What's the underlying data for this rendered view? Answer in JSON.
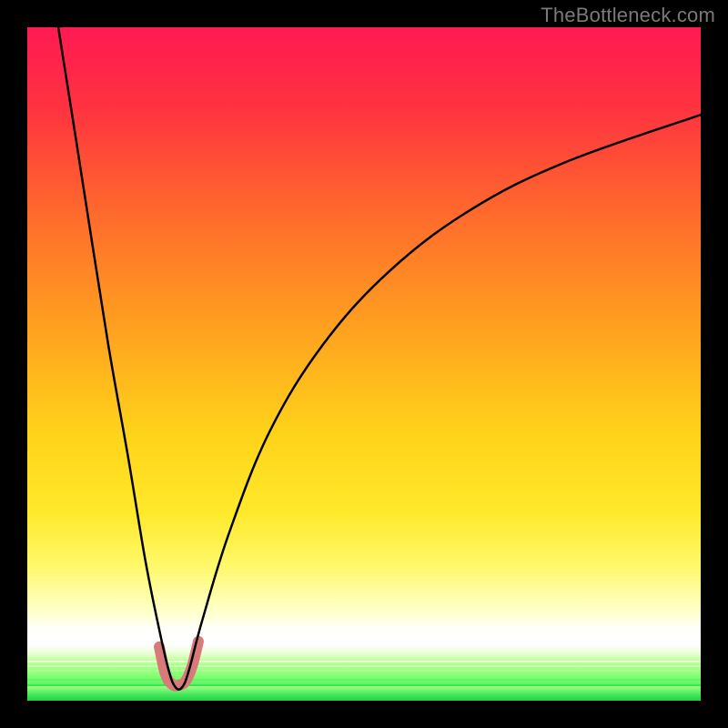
{
  "watermark": "TheBottleneck.com",
  "chart_data": {
    "type": "line",
    "title": "",
    "xlabel": "",
    "ylabel": "",
    "xlim": [
      0,
      100
    ],
    "ylim": [
      0,
      100
    ],
    "grid": false,
    "legend": null,
    "notch_x_percent": 22,
    "series": [
      {
        "name": "gradient-background",
        "kind": "vertical-gradient",
        "stops": [
          {
            "pct": 0,
            "color": "#ff1a52"
          },
          {
            "pct": 12,
            "color": "#ff3340"
          },
          {
            "pct": 28,
            "color": "#ff6b2c"
          },
          {
            "pct": 45,
            "color": "#ffa21f"
          },
          {
            "pct": 60,
            "color": "#ffd21a"
          },
          {
            "pct": 72,
            "color": "#ffe92a"
          },
          {
            "pct": 80,
            "color": "#fff86a"
          },
          {
            "pct": 86,
            "color": "#ffffc0"
          },
          {
            "pct": 90,
            "color": "#ffffff"
          },
          {
            "pct": 93,
            "color": "#d6ffb0"
          },
          {
            "pct": 96,
            "color": "#8eff7a"
          },
          {
            "pct": 100,
            "color": "#1edc46"
          }
        ]
      },
      {
        "name": "bottleneck-curve",
        "kind": "curve",
        "color": "#000000",
        "stroke_width": 2.5,
        "points": [
          {
            "x": 4.6,
            "y": 100.0
          },
          {
            "x": 6.5,
            "y": 88.0
          },
          {
            "x": 9.0,
            "y": 72.0
          },
          {
            "x": 12.0,
            "y": 53.0
          },
          {
            "x": 15.0,
            "y": 36.0
          },
          {
            "x": 17.5,
            "y": 21.0
          },
          {
            "x": 19.5,
            "y": 11.0
          },
          {
            "x": 21.0,
            "y": 4.5
          },
          {
            "x": 22.0,
            "y": 2.0
          },
          {
            "x": 23.0,
            "y": 2.0
          },
          {
            "x": 24.0,
            "y": 4.5
          },
          {
            "x": 26.0,
            "y": 12.0
          },
          {
            "x": 30.0,
            "y": 25.0
          },
          {
            "x": 36.0,
            "y": 40.0
          },
          {
            "x": 44.0,
            "y": 53.0
          },
          {
            "x": 54.0,
            "y": 64.0
          },
          {
            "x": 66.0,
            "y": 73.0
          },
          {
            "x": 80.0,
            "y": 80.0
          },
          {
            "x": 100.0,
            "y": 87.0
          }
        ]
      },
      {
        "name": "valley-marker",
        "kind": "marker",
        "color": "#d97a7a",
        "stroke_width": 12,
        "points": [
          {
            "x": 19.6,
            "y": 8.0
          },
          {
            "x": 20.5,
            "y": 4.0
          },
          {
            "x": 21.5,
            "y": 2.4
          },
          {
            "x": 22.5,
            "y": 2.3
          },
          {
            "x": 23.5,
            "y": 2.9
          },
          {
            "x": 24.5,
            "y": 5.2
          },
          {
            "x": 25.4,
            "y": 8.8
          }
        ]
      }
    ]
  }
}
